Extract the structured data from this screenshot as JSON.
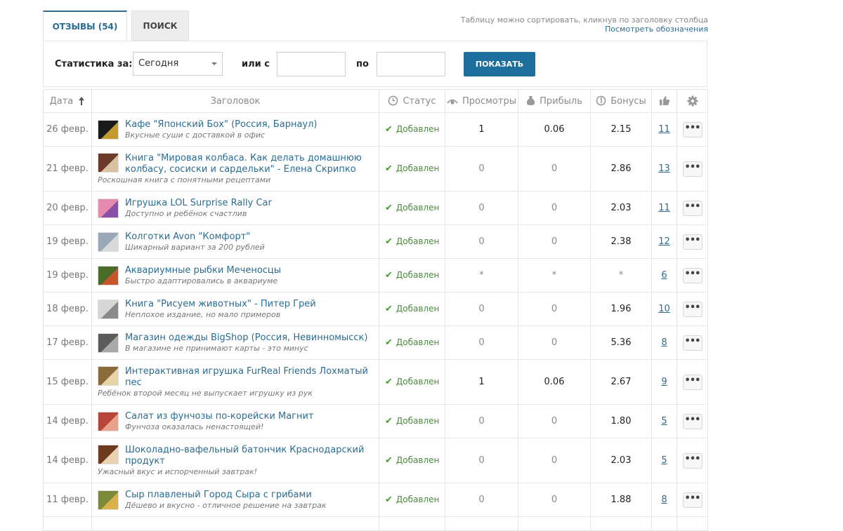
{
  "tabs": [
    {
      "label": "ОТЗЫВЫ (54)"
    },
    {
      "label": "ПОИСК"
    }
  ],
  "hint": {
    "text": "Таблицу можно сортировать, кликнув по заголовку столбца",
    "link": "Посмотреть обозначения"
  },
  "filter": {
    "stats_label": "Статистика за:",
    "select_value": "Сегодня",
    "from_label": "или с",
    "to_label": "по",
    "from_value": "",
    "to_value": "",
    "submit": "ПОКАЗАТЬ"
  },
  "columns": {
    "date": "Дата",
    "title": "Заголовок",
    "status": "Статус",
    "views": "Просмотры",
    "profit": "Прибыль",
    "bonus": "Бонусы"
  },
  "icons": [
    "sort-up-arrow-icon",
    "clock-icon",
    "eye-icon",
    "money-bag-icon",
    "coin-icon",
    "thumbs-up-icon",
    "gear-icon",
    "checkmark-icon",
    "more-dots-icon"
  ],
  "colors": {
    "accent": "#2a6c92",
    "button": "#1e6e9e",
    "status": "#4a8a3a"
  },
  "rows": [
    {
      "date": "26 февр.",
      "title": "Кафе \"Японский Бох\" (Россия, Барнаул)",
      "subtitle": "Вкусные суши с доставкой в офис",
      "status": "Добавлен",
      "views": "1",
      "profit": "0.06",
      "bonus": "2.15",
      "likes": "11"
    },
    {
      "date": "21 февр.",
      "title": "Книга \"Мировая колбаса. Как делать домашнюю колбасу, сосиски и сардельки\" - Елена Скрипко",
      "subtitle": "Роскошная книга с понятными рецептами",
      "status": "Добавлен",
      "views": "0",
      "profit": "0",
      "bonus": "2.86",
      "likes": "13"
    },
    {
      "date": "20 февр.",
      "title": "Игрушка LOL Surprise Rally Car",
      "subtitle": "Доступно и ребёнок счастлив",
      "status": "Добавлен",
      "views": "0",
      "profit": "0",
      "bonus": "2.03",
      "likes": "11"
    },
    {
      "date": "19 февр.",
      "title": "Колготки Avon \"Комфорт\"",
      "subtitle": "Шикарный вариант за 200 рублей",
      "status": "Добавлен",
      "views": "0",
      "profit": "0",
      "bonus": "2.38",
      "likes": "12"
    },
    {
      "date": "19 февр.",
      "title": "Аквариумные рыбки Меченосцы",
      "subtitle": "Быстро адаптировались в аквариуме",
      "status": "Добавлен",
      "views": "*",
      "profit": "*",
      "bonus": "*",
      "likes": "6"
    },
    {
      "date": "18 февр.",
      "title": "Книга \"Рисуем животных\" - Питер Грей",
      "subtitle": "Неплохое издание, но мало примеров",
      "status": "Добавлен",
      "views": "0",
      "profit": "0",
      "bonus": "1.96",
      "likes": "10"
    },
    {
      "date": "17 февр.",
      "title": "Магазин одежды BigShop (Россия, Невинномысск)",
      "subtitle": "В магазине не принимают карты - это минус",
      "status": "Добавлен",
      "views": "0",
      "profit": "0",
      "bonus": "5.36",
      "likes": "8"
    },
    {
      "date": "15 февр.",
      "title": "Интерактивная игрушка FurReal Friends Лохматый пес",
      "subtitle": "Ребёнок второй месяц не выпускает игрушку из рук",
      "status": "Добавлен",
      "views": "1",
      "profit": "0.06",
      "bonus": "2.67",
      "likes": "9"
    },
    {
      "date": "14 февр.",
      "title": "Салат из фунчозы по-корейски Магнит",
      "subtitle": "Фунчоза оказалась ненастоящей!",
      "status": "Добавлен",
      "views": "0",
      "profit": "0",
      "bonus": "1.80",
      "likes": "5"
    },
    {
      "date": "14 февр.",
      "title": "Шоколадно-вафельный батончик Краснодарский продукт",
      "subtitle": "Ужасный вкус и испорченный завтрак!",
      "status": "Добавлен",
      "views": "0",
      "profit": "0",
      "bonus": "2.03",
      "likes": "5"
    },
    {
      "date": "11 февр.",
      "title": "Сыр плавленый Город Сыра с грибами",
      "subtitle": "Дёшево и вкусно - отличное решение на завтрак",
      "status": "Добавлен",
      "views": "0",
      "profit": "0",
      "bonus": "1.88",
      "likes": "8"
    }
  ]
}
